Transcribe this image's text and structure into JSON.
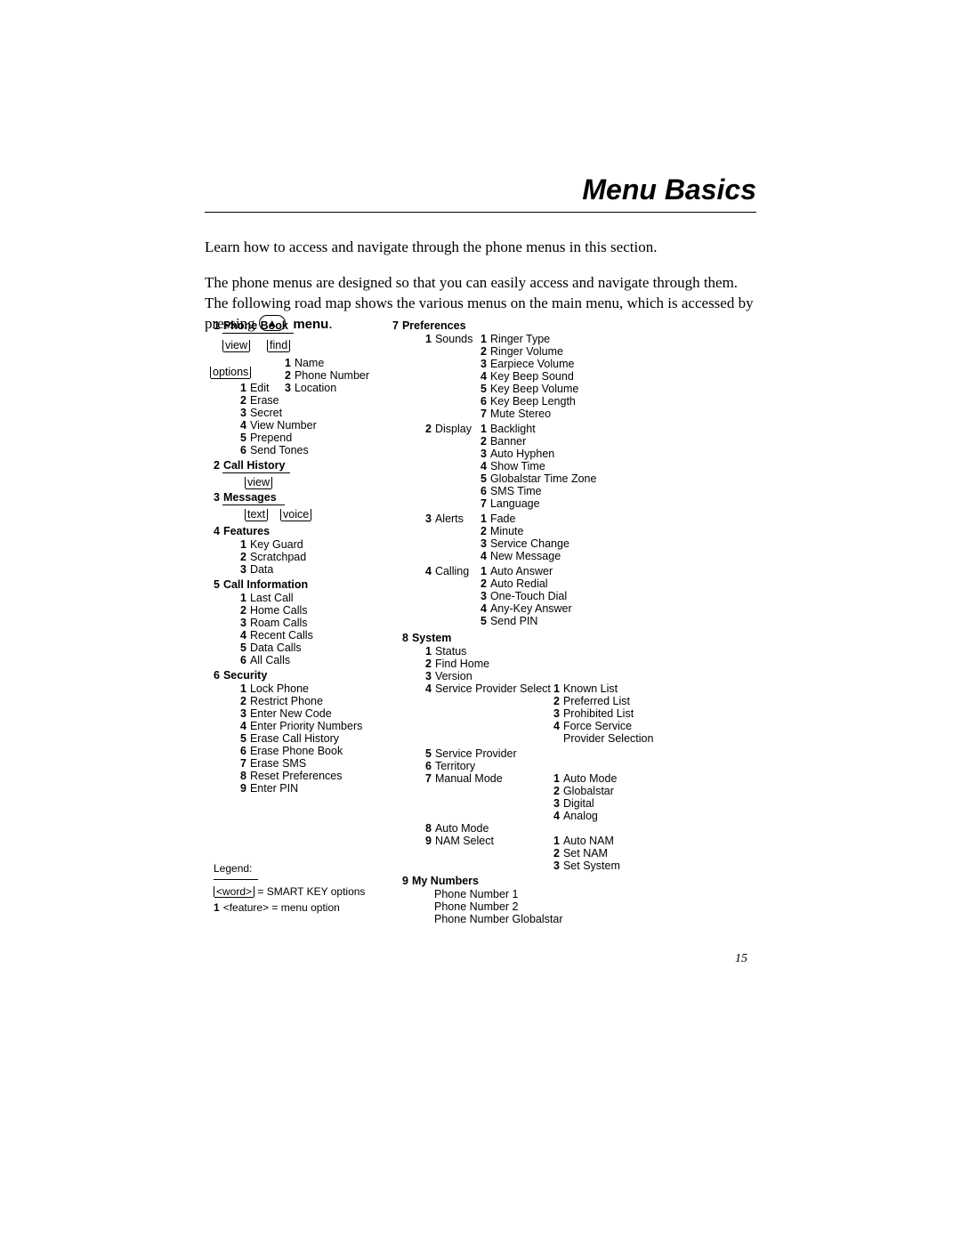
{
  "title": "Menu Basics",
  "intro1": "Learn how to access and navigate through the phone menus in this section.",
  "intro2a": "The phone menus are designed so that you can easily access and navigate through them. The following road map shows the various menus on the main menu, which is accessed by pressing ",
  "intro2_menu": "menu",
  "intro2b": ".",
  "key_glyph": "▲",
  "page_number": "15",
  "legend": {
    "heading": "Legend:",
    "l1_pre": "",
    "l1_word": "<word>",
    "l1_post": " =  SMART KEY options",
    "l2": "<feature> =  menu option",
    "l2_num": "1"
  },
  "m": {
    "sec1": {
      "n": "1",
      "t": "Phone Book"
    },
    "pb_view": "view",
    "pb_find": "find",
    "pb_options": "options",
    "pb_find_1": {
      "n": "1",
      "t": "Name"
    },
    "pb_find_2": {
      "n": "2",
      "t": "Phone Number"
    },
    "pb_find_3": {
      "n": "3",
      "t": "Location"
    },
    "pb_opt_1": {
      "n": "1",
      "t": "Edit"
    },
    "pb_opt_2": {
      "n": "2",
      "t": "Erase"
    },
    "pb_opt_3": {
      "n": "3",
      "t": "Secret"
    },
    "pb_opt_4": {
      "n": "4",
      "t": "View Number"
    },
    "pb_opt_5": {
      "n": "5",
      "t": "Prepend"
    },
    "pb_opt_6": {
      "n": "6",
      "t": "Send Tones"
    },
    "sec2": {
      "n": "2",
      "t": "Call History"
    },
    "ch_view": "view",
    "sec3": {
      "n": "3",
      "t": "Messages"
    },
    "msg_text": "text",
    "msg_voice": "voice",
    "sec4": {
      "n": "4",
      "t": "Features"
    },
    "f1": {
      "n": "1",
      "t": "Key Guard"
    },
    "f2": {
      "n": "2",
      "t": "Scratchpad"
    },
    "f3": {
      "n": "3",
      "t": "Data"
    },
    "sec5": {
      "n": "5",
      "t": "Call Information"
    },
    "ci1": {
      "n": "1",
      "t": "Last Call"
    },
    "ci2": {
      "n": "2",
      "t": "Home Calls"
    },
    "ci3": {
      "n": "3",
      "t": "Roam Calls"
    },
    "ci4": {
      "n": "4",
      "t": "Recent Calls"
    },
    "ci5": {
      "n": "5",
      "t": "Data Calls"
    },
    "ci6": {
      "n": "6",
      "t": "All Calls"
    },
    "sec6": {
      "n": "6",
      "t": "Security"
    },
    "se1": {
      "n": "1",
      "t": "Lock Phone"
    },
    "se2": {
      "n": "2",
      "t": "Restrict Phone"
    },
    "se3": {
      "n": "3",
      "t": "Enter New Code"
    },
    "se4": {
      "n": "4",
      "t": "Enter Priority Numbers"
    },
    "se5": {
      "n": "5",
      "t": "Erase Call History"
    },
    "se6": {
      "n": "6",
      "t": "Erase Phone Book"
    },
    "se7": {
      "n": "7",
      "t": "Erase SMS"
    },
    "se8": {
      "n": "8",
      "t": "Reset Preferences"
    },
    "se9": {
      "n": "9",
      "t": "Enter PIN"
    },
    "sec7": {
      "n": "7",
      "t": "Preferences"
    },
    "p1": {
      "n": "1",
      "t": "Sounds"
    },
    "p1_1": {
      "n": "1",
      "t": "Ringer Type"
    },
    "p1_2": {
      "n": "2",
      "t": "Ringer Volume"
    },
    "p1_3": {
      "n": "3",
      "t": "Earpiece Volume"
    },
    "p1_4": {
      "n": "4",
      "t": "Key Beep Sound"
    },
    "p1_5": {
      "n": "5",
      "t": "Key Beep Volume"
    },
    "p1_6": {
      "n": "6",
      "t": "Key Beep Length"
    },
    "p1_7": {
      "n": "7",
      "t": "Mute Stereo"
    },
    "p2": {
      "n": "2",
      "t": "Display"
    },
    "p2_1": {
      "n": "1",
      "t": "Backlight"
    },
    "p2_2": {
      "n": "2",
      "t": "Banner"
    },
    "p2_3": {
      "n": "3",
      "t": "Auto Hyphen"
    },
    "p2_4": {
      "n": "4",
      "t": "Show Time"
    },
    "p2_5": {
      "n": "5",
      "t": "Globalstar Time Zone"
    },
    "p2_6": {
      "n": "6",
      "t": "SMS Time"
    },
    "p2_7": {
      "n": "7",
      "t": "Language"
    },
    "p3": {
      "n": "3",
      "t": "Alerts"
    },
    "p3_1": {
      "n": "1",
      "t": "Fade"
    },
    "p3_2": {
      "n": "2",
      "t": "Minute"
    },
    "p3_3": {
      "n": "3",
      "t": "Service Change"
    },
    "p3_4": {
      "n": "4",
      "t": "New Message"
    },
    "p4": {
      "n": "4",
      "t": "Calling"
    },
    "p4_1": {
      "n": "1",
      "t": "Auto Answer"
    },
    "p4_2": {
      "n": "2",
      "t": "Auto Redial"
    },
    "p4_3": {
      "n": "3",
      "t": "One-Touch Dial"
    },
    "p4_4": {
      "n": "4",
      "t": "Any-Key Answer"
    },
    "p4_5": {
      "n": "5",
      "t": "Send PIN"
    },
    "sec8": {
      "n": "8",
      "t": "System"
    },
    "sy1": {
      "n": "1",
      "t": "Status"
    },
    "sy2": {
      "n": "2",
      "t": "Find Home"
    },
    "sy3": {
      "n": "3",
      "t": "Version"
    },
    "sy4": {
      "n": "4",
      "t": "Service Provider Select"
    },
    "sy4_1": {
      "n": "1",
      "t": "Known List"
    },
    "sy4_2": {
      "n": "2",
      "t": "Preferred List"
    },
    "sy4_3": {
      "n": "3",
      "t": "Prohibited List"
    },
    "sy4_4": {
      "n": "4",
      "t": "Force Service"
    },
    "sy4_4b": "Provider Selection",
    "sy5": {
      "n": "5",
      "t": "Service Provider"
    },
    "sy6": {
      "n": "6",
      "t": "Territory"
    },
    "sy7": {
      "n": "7",
      "t": "Manual Mode"
    },
    "sy7_1": {
      "n": "1",
      "t": "Auto Mode"
    },
    "sy7_2": {
      "n": "2",
      "t": "Globalstar"
    },
    "sy7_3": {
      "n": "3",
      "t": "Digital"
    },
    "sy7_4": {
      "n": "4",
      "t": "Analog"
    },
    "sy8": {
      "n": "8",
      "t": "Auto Mode"
    },
    "sy9": {
      "n": "9",
      "t": "NAM Select"
    },
    "sy9_1": {
      "n": "1",
      "t": "Auto NAM"
    },
    "sy9_2": {
      "n": "2",
      "t": "Set NAM"
    },
    "sy9_3": {
      "n": "3",
      "t": "Set System"
    },
    "sec9": {
      "n": "9",
      "t": "My Numbers"
    },
    "mn1": "Phone Number 1",
    "mn2": "Phone Number 2",
    "mn3": "Phone Number Globalstar"
  }
}
